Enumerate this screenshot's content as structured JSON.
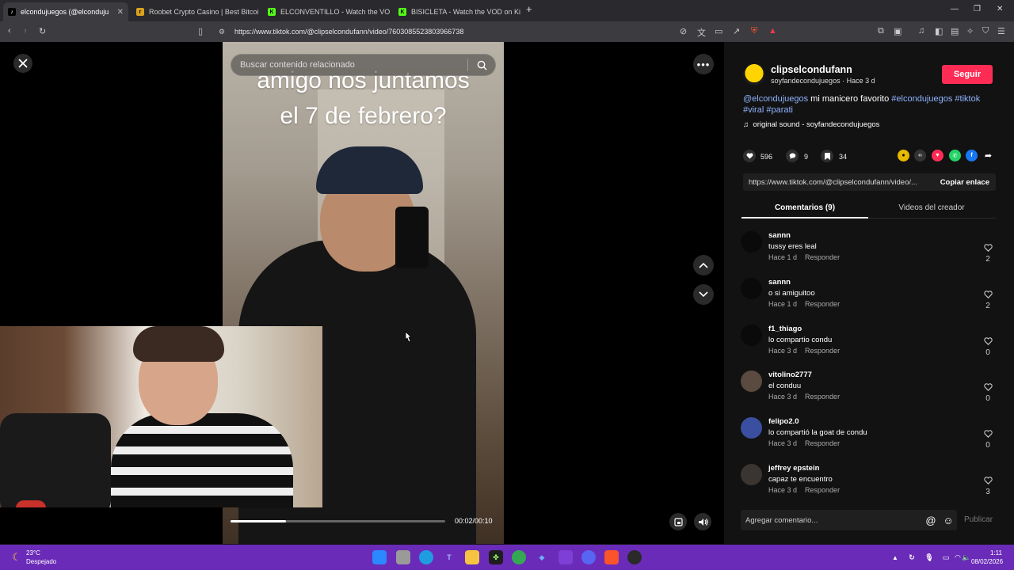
{
  "browser": {
    "tabs": [
      {
        "title": "elcondujuegos (@elconduju",
        "active": true,
        "favicon": "tiktok-icon"
      },
      {
        "title": "Roobet Crypto Casino | Best Bitcoin C",
        "active": false,
        "favicon": "roobet-icon"
      },
      {
        "title": "ELCONVENTILLO - Watch the VOD on",
        "active": false,
        "favicon": "kick-icon"
      },
      {
        "title": "BISICLETA - Watch the VOD on Kick",
        "active": false,
        "favicon": "kick-icon"
      }
    ],
    "new_tab": "+",
    "url": "https://www.tiktok.com/@clipselcondufann/video/7603085523803966738"
  },
  "video": {
    "search_placeholder": "Buscar contenido relacionado",
    "caption_line1": "amigo nos juntamos",
    "caption_line2": "el 7 de febrero?",
    "time": "00:02/00:10",
    "progress": 0.26
  },
  "post": {
    "username": "clipselcondufann",
    "handle": "soyfandecondujuegos",
    "posted": "Hace 3 d",
    "follow_label": "Seguir",
    "mention": "@elcondujuegos",
    "description": " mi manicero favorito ",
    "tags": [
      "#elcondujuegos",
      "#tiktok",
      "#viral",
      "#parati"
    ],
    "sound": "original sound - soyfandecondujuegos",
    "likes": "596",
    "comments_count": "9",
    "saves": "34",
    "link": "https://www.tiktok.com/@clipselcondufann/video/...",
    "copy_label": "Copiar enlace",
    "tab_comments": "Comentarios (9)",
    "tab_creator": "Videos del creador"
  },
  "comments": [
    {
      "user": "sannn",
      "text": "tussy eres leal",
      "time": "Hace 1 d",
      "reply": "Responder",
      "likes": "2"
    },
    {
      "user": "sannn",
      "text": "o si amiguitoo",
      "time": "Hace 1 d",
      "reply": "Responder",
      "likes": "2"
    },
    {
      "user": "f1_thiago",
      "text": "lo compartio condu",
      "time": "Hace 3 d",
      "reply": "Responder",
      "likes": "0"
    },
    {
      "user": "vitolino2777",
      "text": "el conduu",
      "time": "Hace 3 d",
      "reply": "Responder",
      "likes": "0"
    },
    {
      "user": "felipo2.0",
      "text": "lo compartió la goat de condu",
      "time": "Hace 3 d",
      "reply": "Responder",
      "likes": "0"
    },
    {
      "user": "jeffrey epstein",
      "text": "capaz te encuentro",
      "time": "Hace 3 d",
      "reply": "Responder",
      "likes": "3"
    }
  ],
  "comment_box": {
    "placeholder": "Agregar comentario...",
    "publish": "Publicar"
  },
  "taskbar": {
    "weather_temp": "23°C",
    "weather_desc": "Despejado",
    "time": "1:11",
    "date": "08/02/2026"
  },
  "colors": {
    "accent": "#fe2c55",
    "hashtag": "#8fb3ff",
    "taskbar": "#6a2bb8"
  }
}
